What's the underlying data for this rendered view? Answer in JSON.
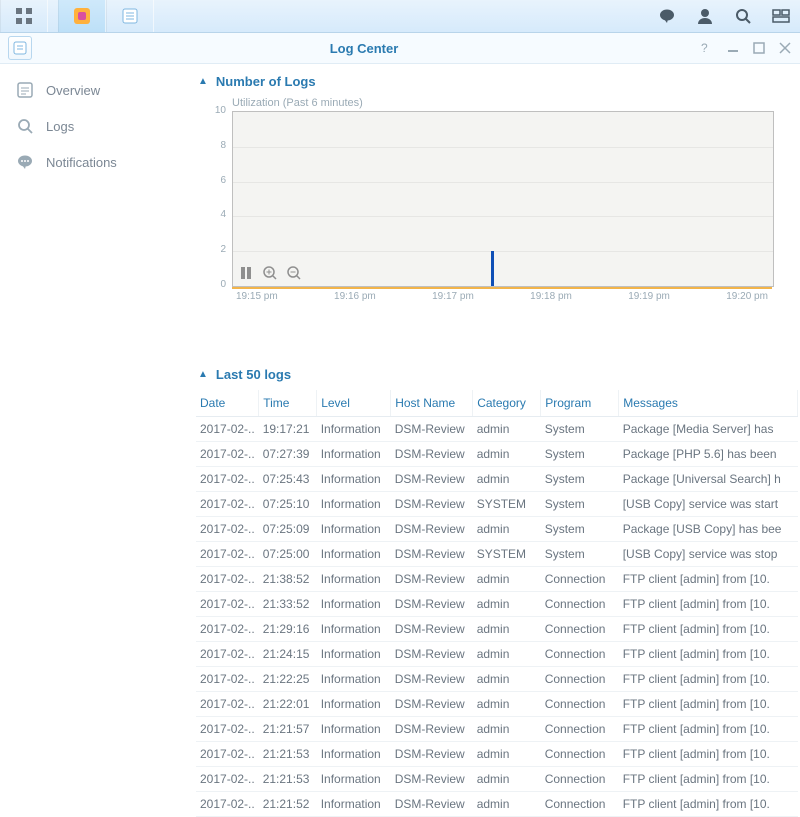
{
  "taskbar": {
    "buttons": [
      "apps",
      "package-center",
      "log-center"
    ],
    "right": [
      "messages",
      "user",
      "search",
      "widgets"
    ]
  },
  "window": {
    "title": "Log Center",
    "controls": [
      "help",
      "minimize",
      "maximize",
      "close"
    ]
  },
  "sidebar": {
    "items": [
      {
        "label": "Overview",
        "icon": "overview-icon"
      },
      {
        "label": "Logs",
        "icon": "search-icon"
      },
      {
        "label": "Notifications",
        "icon": "speech-icon"
      }
    ]
  },
  "sections": {
    "chart_header": "Number of Logs",
    "logs_header": "Last 50 logs"
  },
  "chart_data": {
    "type": "line",
    "title": "Utilization (Past 6 minutes)",
    "xlabel": "",
    "ylabel": "",
    "ylim": [
      0,
      10
    ],
    "yticks": [
      0,
      2,
      4,
      6,
      8,
      10
    ],
    "x_categories": [
      "19:15 pm",
      "19:16 pm",
      "19:17 pm",
      "19:18 pm",
      "19:19 pm",
      "19:20 pm"
    ],
    "series": [
      {
        "name": "logs",
        "values": [
          0,
          0,
          2,
          0,
          0,
          0
        ],
        "peak_index": 2.4,
        "peak_value": 2
      }
    ],
    "controls": [
      "pause",
      "zoom-in",
      "zoom-out"
    ]
  },
  "logs_table": {
    "columns": [
      "Date",
      "Time",
      "Level",
      "Host Name",
      "Category",
      "Program",
      "Messages"
    ],
    "rows": [
      {
        "date": "2017-02-..",
        "time": "19:17:21",
        "level": "Information",
        "host": "DSM-Review",
        "category": "admin",
        "program": "System",
        "msg": "Package [Media Server] has"
      },
      {
        "date": "2017-02-..",
        "time": "07:27:39",
        "level": "Information",
        "host": "DSM-Review",
        "category": "admin",
        "program": "System",
        "msg": "Package [PHP 5.6] has been"
      },
      {
        "date": "2017-02-..",
        "time": "07:25:43",
        "level": "Information",
        "host": "DSM-Review",
        "category": "admin",
        "program": "System",
        "msg": "Package [Universal Search] h"
      },
      {
        "date": "2017-02-..",
        "time": "07:25:10",
        "level": "Information",
        "host": "DSM-Review",
        "category": "SYSTEM",
        "program": "System",
        "msg": "[USB Copy] service was start"
      },
      {
        "date": "2017-02-..",
        "time": "07:25:09",
        "level": "Information",
        "host": "DSM-Review",
        "category": "admin",
        "program": "System",
        "msg": "Package [USB Copy] has bee"
      },
      {
        "date": "2017-02-..",
        "time": "07:25:00",
        "level": "Information",
        "host": "DSM-Review",
        "category": "SYSTEM",
        "program": "System",
        "msg": "[USB Copy] service was stop"
      },
      {
        "date": "2017-02-..",
        "time": "21:38:52",
        "level": "Information",
        "host": "DSM-Review",
        "category": "admin",
        "program": "Connection",
        "msg": "FTP client [admin] from [10."
      },
      {
        "date": "2017-02-..",
        "time": "21:33:52",
        "level": "Information",
        "host": "DSM-Review",
        "category": "admin",
        "program": "Connection",
        "msg": "FTP client [admin] from [10."
      },
      {
        "date": "2017-02-..",
        "time": "21:29:16",
        "level": "Information",
        "host": "DSM-Review",
        "category": "admin",
        "program": "Connection",
        "msg": "FTP client [admin] from [10."
      },
      {
        "date": "2017-02-..",
        "time": "21:24:15",
        "level": "Information",
        "host": "DSM-Review",
        "category": "admin",
        "program": "Connection",
        "msg": "FTP client [admin] from [10."
      },
      {
        "date": "2017-02-..",
        "time": "21:22:25",
        "level": "Information",
        "host": "DSM-Review",
        "category": "admin",
        "program": "Connection",
        "msg": "FTP client [admin] from [10."
      },
      {
        "date": "2017-02-..",
        "time": "21:22:01",
        "level": "Information",
        "host": "DSM-Review",
        "category": "admin",
        "program": "Connection",
        "msg": "FTP client [admin] from [10."
      },
      {
        "date": "2017-02-..",
        "time": "21:21:57",
        "level": "Information",
        "host": "DSM-Review",
        "category": "admin",
        "program": "Connection",
        "msg": "FTP client [admin] from [10."
      },
      {
        "date": "2017-02-..",
        "time": "21:21:53",
        "level": "Information",
        "host": "DSM-Review",
        "category": "admin",
        "program": "Connection",
        "msg": "FTP client [admin] from [10."
      },
      {
        "date": "2017-02-..",
        "time": "21:21:53",
        "level": "Information",
        "host": "DSM-Review",
        "category": "admin",
        "program": "Connection",
        "msg": "FTP client [admin] from [10."
      },
      {
        "date": "2017-02-..",
        "time": "21:21:52",
        "level": "Information",
        "host": "DSM-Review",
        "category": "admin",
        "program": "Connection",
        "msg": "FTP client [admin] from [10."
      }
    ]
  }
}
